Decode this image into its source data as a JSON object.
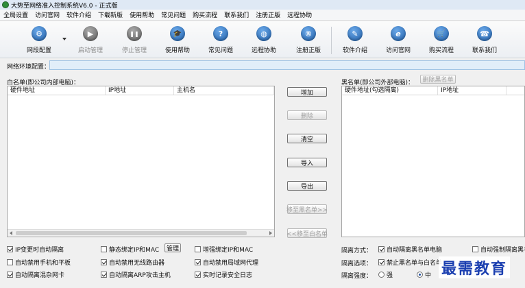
{
  "window": {
    "title": "大势至网络准入控制系统V6.0 - 正式版"
  },
  "menu": [
    "全局设置",
    "访问官网",
    "软件介绍",
    "下载新版",
    "使用帮助",
    "常见问题",
    "购买流程",
    "联系我们",
    "注册正版",
    "远程协助"
  ],
  "toolbar": [
    {
      "label": "网段配置",
      "icon": "gear-icon",
      "glyph": "⚙",
      "color": "blue",
      "enabled": true
    },
    {
      "label": "启动管理",
      "icon": "play-icon",
      "glyph": "▶",
      "color": "gray",
      "enabled": false
    },
    {
      "label": "停止管理",
      "icon": "pause-icon",
      "glyph": "❚❚",
      "color": "gray",
      "enabled": false
    },
    {
      "label": "使用帮助",
      "icon": "graduation-cap-icon",
      "glyph": "🎓",
      "color": "blue",
      "enabled": true
    },
    {
      "label": "常见问题",
      "icon": "question-icon",
      "glyph": "?",
      "color": "blue",
      "enabled": true
    },
    {
      "label": "远程协助",
      "icon": "globe-icon",
      "glyph": "◍",
      "color": "blue",
      "enabled": true
    },
    {
      "label": "注册正版",
      "icon": "registered-icon",
      "glyph": "®",
      "color": "blue",
      "enabled": true
    },
    {
      "label": "软件介绍",
      "icon": "pen-icon",
      "glyph": "✎",
      "color": "blue",
      "enabled": true
    },
    {
      "label": "访问官网",
      "icon": "ie-icon",
      "glyph": "e",
      "color": "blue",
      "enabled": true
    },
    {
      "label": "购买流程",
      "icon": "cart-icon",
      "glyph": "🛒",
      "color": "blue",
      "enabled": true
    },
    {
      "label": "联系我们",
      "icon": "phone-icon",
      "glyph": "☎",
      "color": "blue",
      "enabled": true
    }
  ],
  "network": {
    "label": "网络环境配置：",
    "value": ""
  },
  "whitelist": {
    "label": "白名单(即公司内部电脑)：",
    "columns": [
      "硬件地址",
      "IP地址",
      "主机名"
    ]
  },
  "blacklist": {
    "label": "黑名单(即公司外部电脑)：",
    "delete_label": "删除黑名单",
    "columns": [
      "硬件地址(勾选隔离)",
      "IP地址"
    ]
  },
  "actions": {
    "add": "增加",
    "delete": "删除",
    "clear": "清空",
    "import": "导入",
    "export": "导出",
    "move_to_black": "移至黑名单>>",
    "move_to_white": "<<移至白名单"
  },
  "options": {
    "ip_change_isolate": {
      "label": "IP变更时自动隔离",
      "checked": true
    },
    "static_bind": {
      "label": "静态绑定IP和MAC",
      "checked": false
    },
    "manage_button": "管理",
    "enhanced_bind": {
      "label": "增强绑定IP和MAC",
      "checked": false
    },
    "disable_mobile": {
      "label": "自动禁用手机和平板",
      "checked": false
    },
    "disable_wireless_router": {
      "label": "自动禁用无线路由器",
      "checked": true
    },
    "disable_lan_proxy": {
      "label": "自动禁用局域网代理",
      "checked": true
    },
    "isolate_mixed_nic": {
      "label": "自动隔离混杂网卡",
      "checked": true
    },
    "isolate_arp_attack": {
      "label": "自动隔离ARP攻击主机",
      "checked": true
    },
    "realtime_log": {
      "label": "实时记录安全日志",
      "checked": true
    }
  },
  "isolation": {
    "mode_label": "隔离方式：",
    "auto_isolate_black": {
      "label": "自动隔离黑名单电脑",
      "checked": true
    },
    "force_isolate_black": {
      "label": "自动强制隔离黑名",
      "checked": false
    },
    "option_label": "隔离选项：",
    "block_black_white": {
      "label": "禁止黑名单与白名单",
      "checked": true
    },
    "strength_label": "隔离强度：",
    "strength_options": [
      "强",
      "中"
    ],
    "strength_selected": "中"
  },
  "watermark": "最需教育"
}
